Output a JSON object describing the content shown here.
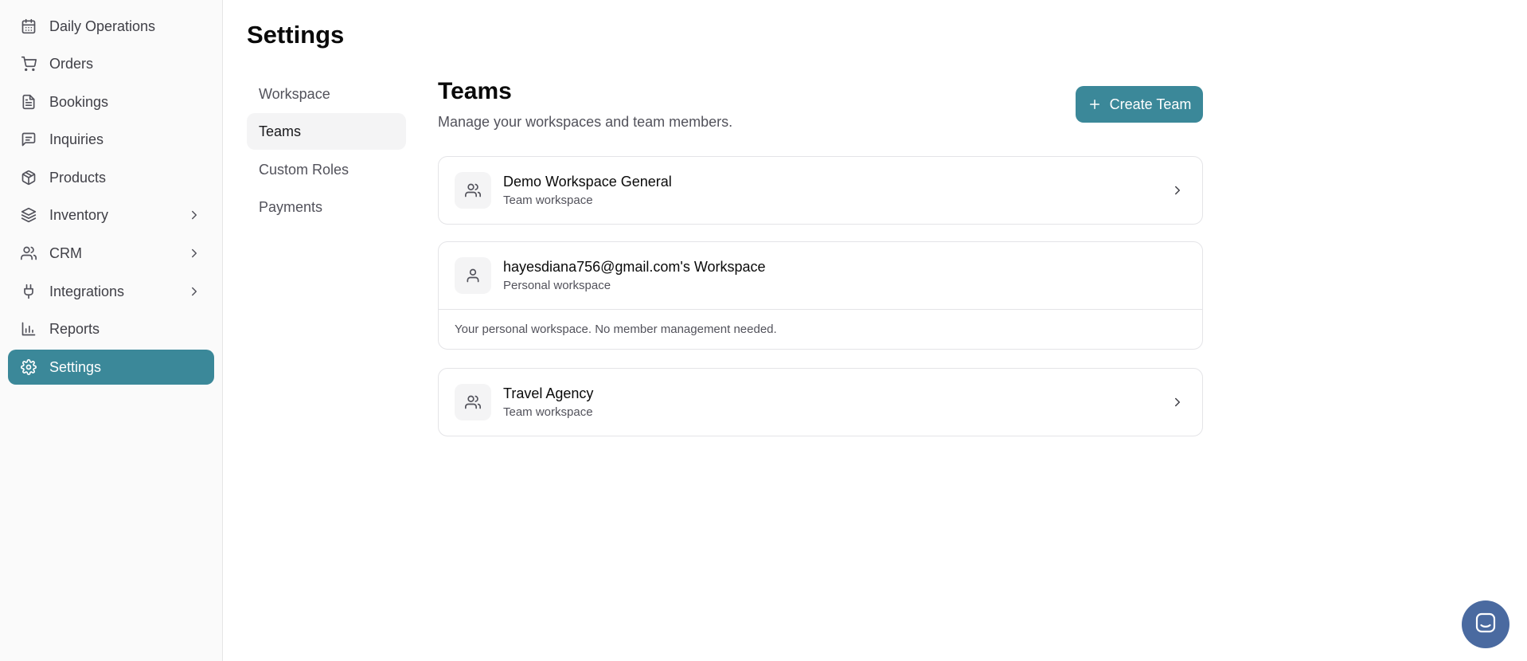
{
  "sidebar": {
    "items": [
      {
        "label": "Daily Operations",
        "icon": "calendar-icon"
      },
      {
        "label": "Orders",
        "icon": "cart-icon"
      },
      {
        "label": "Bookings",
        "icon": "document-icon"
      },
      {
        "label": "Inquiries",
        "icon": "message-icon"
      },
      {
        "label": "Products",
        "icon": "package-icon"
      },
      {
        "label": "Inventory",
        "icon": "layers-icon"
      },
      {
        "label": "CRM",
        "icon": "users-icon"
      },
      {
        "label": "Integrations",
        "icon": "plug-icon"
      },
      {
        "label": "Reports",
        "icon": "bar-chart-icon"
      },
      {
        "label": "Settings",
        "icon": "gear-icon"
      }
    ]
  },
  "page": {
    "title": "Settings"
  },
  "subnav": {
    "items": [
      {
        "label": "Workspace"
      },
      {
        "label": "Teams"
      },
      {
        "label": "Custom Roles"
      },
      {
        "label": "Payments"
      }
    ]
  },
  "teams": {
    "title": "Teams",
    "subtitle": "Manage your workspaces and team members.",
    "create_label": "Create Team",
    "workspaces": [
      {
        "name": "Demo Workspace General",
        "type": "Team workspace"
      },
      {
        "name": "hayesdiana756@gmail.com's Workspace",
        "type": "Personal workspace",
        "note": "Your personal workspace. No member management needed."
      },
      {
        "name": "Travel Agency",
        "type": "Team workspace"
      }
    ]
  },
  "colors": {
    "accent": "#3b8899",
    "chat": "#4a6aa0"
  }
}
